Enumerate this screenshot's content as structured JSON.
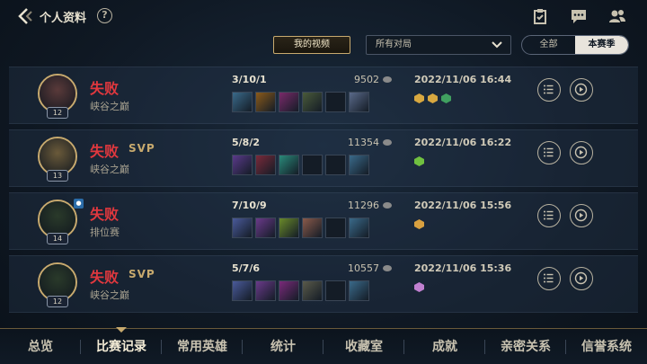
{
  "header": {
    "title": "个人资料",
    "help": "?"
  },
  "filters": {
    "my_videos_label": "我的视频",
    "mode_select_value": "所有对局",
    "segment": [
      "全部",
      "本赛季"
    ],
    "segment_active": 1
  },
  "matches": [
    {
      "level": "12",
      "result": "失败",
      "svp": "",
      "mode": "峡谷之巅",
      "kda": "3/10/1",
      "gold": "9502",
      "time": "2022/11/06 16:44",
      "team_badge": false,
      "item_colors": [
        "#3a6a8a",
        "#8a5a1a",
        "#7a2a6a",
        "#4a5a3a",
        "",
        "#5a6a8a"
      ],
      "tag_colors": [
        "#d8a840",
        "#d8a840",
        "#40a060"
      ],
      "avatar_color": "#5a3a3a"
    },
    {
      "level": "13",
      "result": "失败",
      "svp": "SVP",
      "mode": "峡谷之巅",
      "kda": "5/8/2",
      "gold": "11354",
      "time": "2022/11/06 16:22",
      "team_badge": false,
      "item_colors": [
        "#5a3a8a",
        "#7a2a3a",
        "#2a8a7a",
        "",
        "",
        "#3a6a8a"
      ],
      "tag_colors": [
        "#70c040"
      ],
      "avatar_color": "#6a5a3a"
    },
    {
      "level": "14",
      "result": "失败",
      "svp": "",
      "mode": "排位赛",
      "kda": "7/10/9",
      "gold": "11296",
      "time": "2022/11/06 15:56",
      "team_badge": true,
      "item_colors": [
        "#4a5a9a",
        "#6a3a8a",
        "#6a8a2a",
        "#8a5a4a",
        "",
        "#3a6a8a"
      ],
      "tag_colors": [
        "#d8a040"
      ],
      "avatar_color": "#2a3a2a"
    },
    {
      "level": "12",
      "result": "失败",
      "svp": "SVP",
      "mode": "峡谷之巅",
      "kda": "5/7/6",
      "gold": "10557",
      "time": "2022/11/06 15:36",
      "team_badge": false,
      "item_colors": [
        "#4a5a9a",
        "#6a3a8a",
        "#7a2a7a",
        "#5a5a4a",
        "",
        "#3a6a8a"
      ],
      "tag_colors": [
        "#c080d0"
      ],
      "avatar_color": "#2a3a2a"
    }
  ],
  "nav": {
    "items": [
      "总览",
      "比赛记录",
      "常用英雄",
      "统计",
      "收藏室",
      "成就",
      "亲密关系",
      "信誉系统"
    ],
    "active": 1
  },
  "colors": {
    "accent_gold": "#c8aa6e",
    "defeat_red": "#e0383e"
  }
}
